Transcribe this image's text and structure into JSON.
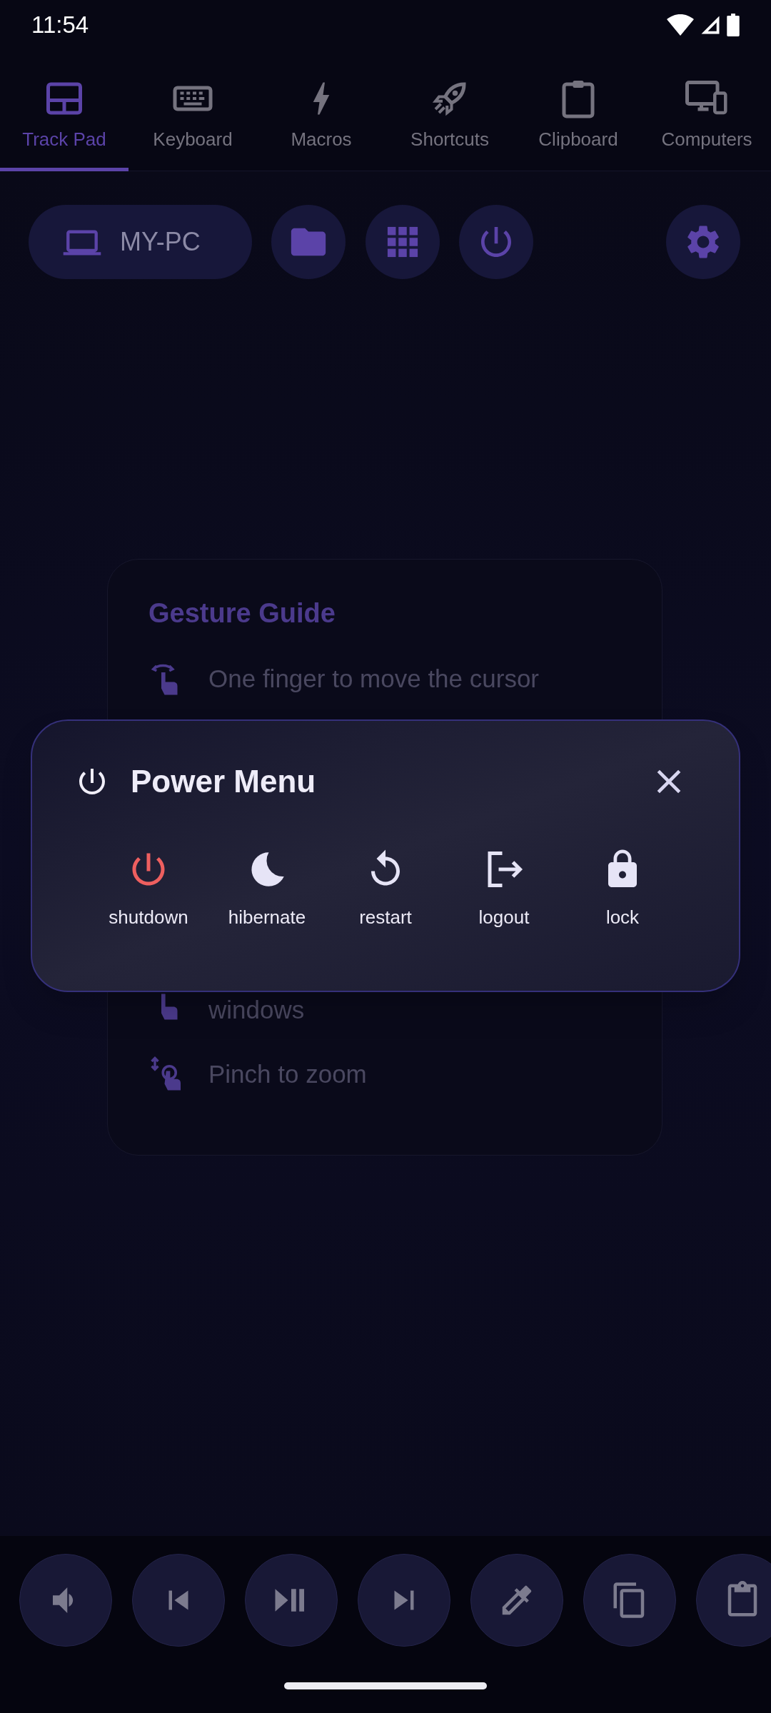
{
  "status_bar": {
    "time": "11:54"
  },
  "tabs": [
    {
      "label": "Track Pad",
      "selected": true
    },
    {
      "label": "Keyboard",
      "selected": false
    },
    {
      "label": "Macros",
      "selected": false
    },
    {
      "label": "Shortcuts",
      "selected": false
    },
    {
      "label": "Clipboard",
      "selected": false
    },
    {
      "label": "Computers",
      "selected": false
    }
  ],
  "device": {
    "name": "MY-PC"
  },
  "gesture_guide": {
    "title": "Gesture Guide",
    "items": [
      {
        "text": "One finger to move the cursor"
      },
      {
        "text": "windows"
      },
      {
        "text": "Pinch to zoom"
      }
    ]
  },
  "power_menu": {
    "title": "Power Menu",
    "actions": [
      {
        "label": "shutdown",
        "color": "#ee5f5f"
      },
      {
        "label": "hibernate",
        "color": "#e6e4f6"
      },
      {
        "label": "restart",
        "color": "#e6e4f6"
      },
      {
        "label": "logout",
        "color": "#e6e4f6"
      },
      {
        "label": "lock",
        "color": "#e6e4f6"
      }
    ]
  }
}
